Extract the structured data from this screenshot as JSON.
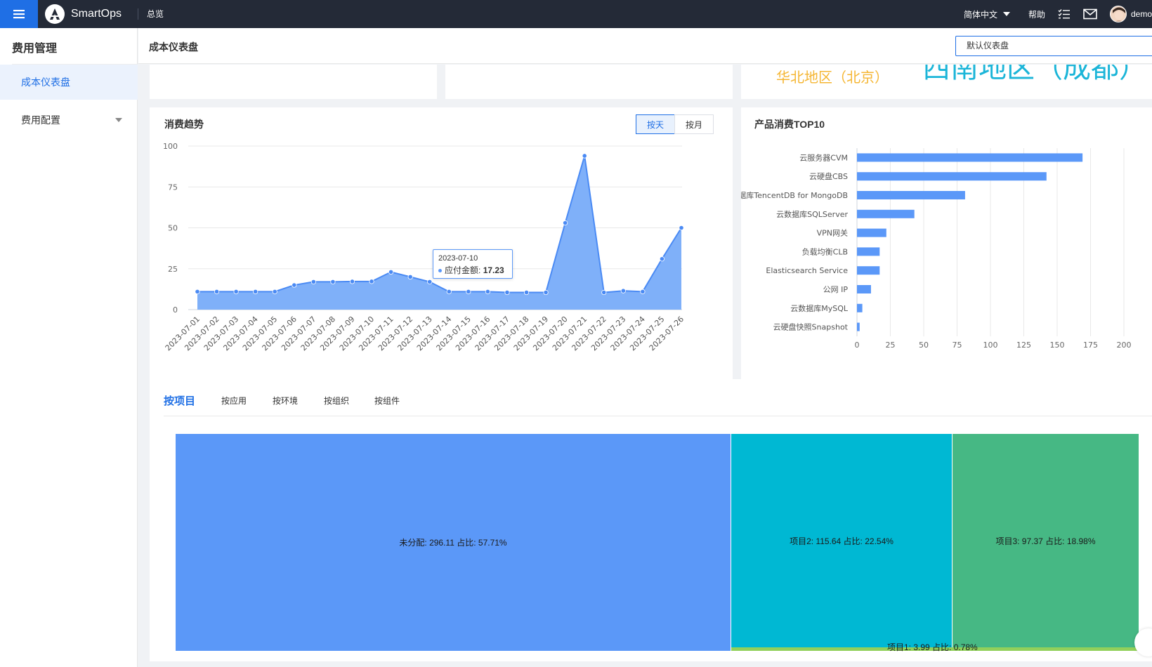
{
  "topbar": {
    "app_name": "SmartOps",
    "breadcrumb": "总览",
    "language": "简体中文",
    "help": "帮助",
    "user": "demo"
  },
  "sidebar": {
    "title": "费用管理",
    "items": [
      {
        "label": "成本仪表盘",
        "active": true
      },
      {
        "label": "费用配置",
        "active": false
      }
    ]
  },
  "header": {
    "title": "成本仪表盘",
    "dashboard_select": "默认仪表盘"
  },
  "regions": {
    "region_a": "华北地区（北京）",
    "region_b": "西南地区（成都）"
  },
  "trend": {
    "title": "消费趋势",
    "toggle": [
      {
        "label": "按天",
        "selected": true
      },
      {
        "label": "按月",
        "selected": false
      }
    ],
    "tooltip": {
      "date": "2023-07-10",
      "label": "应付金额:",
      "value": "17.23"
    }
  },
  "top10": {
    "title": "产品消费TOP10"
  },
  "breakdown": {
    "tabs": [
      {
        "label": "按项目",
        "selected": true
      },
      {
        "label": "按应用",
        "selected": false
      },
      {
        "label": "按环境",
        "selected": false
      },
      {
        "label": "按组织",
        "selected": false
      },
      {
        "label": "按组件",
        "selected": false
      }
    ],
    "treemap": [
      {
        "label": "未分配: 296.11 占比: 57.71%",
        "value": 296.11,
        "color": "#5b98f8"
      },
      {
        "label": "项目2: 115.64 占比: 22.54%",
        "value": 115.64,
        "color": "#00b8d3"
      },
      {
        "label": "项目3: 97.37 占比: 18.98%",
        "value": 97.37,
        "color": "#46b884"
      },
      {
        "label": "项目1: 3.99 占比: 0.78%",
        "value": 3.99,
        "color": "#92d05a"
      }
    ]
  },
  "chart_data": [
    {
      "type": "area",
      "title": "消费趋势",
      "x": [
        "2023-07-01",
        "2023-07-02",
        "2023-07-03",
        "2023-07-04",
        "2023-07-05",
        "2023-07-06",
        "2023-07-07",
        "2023-07-08",
        "2023-07-09",
        "2023-07-10",
        "2023-07-11",
        "2023-07-12",
        "2023-07-13",
        "2023-07-14",
        "2023-07-15",
        "2023-07-16",
        "2023-07-17",
        "2023-07-18",
        "2023-07-19",
        "2023-07-20",
        "2023-07-21",
        "2023-07-22",
        "2023-07-23",
        "2023-07-24",
        "2023-07-25",
        "2023-07-26"
      ],
      "series": [
        {
          "name": "应付金额",
          "values": [
            11,
            11,
            11,
            11,
            11,
            15,
            17,
            17,
            17.2,
            17.23,
            23,
            20,
            17,
            11,
            11,
            11,
            10.5,
            10.5,
            10.5,
            53,
            94,
            10.5,
            11.5,
            11,
            31,
            50
          ]
        }
      ],
      "ylim": [
        0,
        100
      ],
      "yticks": [
        0,
        25,
        50,
        75,
        100
      ],
      "grid": true
    },
    {
      "type": "bar",
      "orientation": "horizontal",
      "title": "产品消费TOP10",
      "categories": [
        "云服务器CVM",
        "云硬盘CBS",
        "云数据库TencentDB for MongoDB",
        "云数据库SQLServer",
        "VPN网关",
        "负载均衡CLB",
        "Elasticsearch Service",
        "公网 IP",
        "云数据库MySQL",
        "云硬盘快照Snapshot"
      ],
      "values": [
        169,
        142,
        81,
        43,
        22,
        17,
        17,
        10.5,
        4,
        2
      ],
      "xlim": [
        0,
        200
      ],
      "xticks": [
        0,
        25,
        50,
        75,
        100,
        125,
        150,
        175,
        200
      ],
      "grid": true
    }
  ]
}
